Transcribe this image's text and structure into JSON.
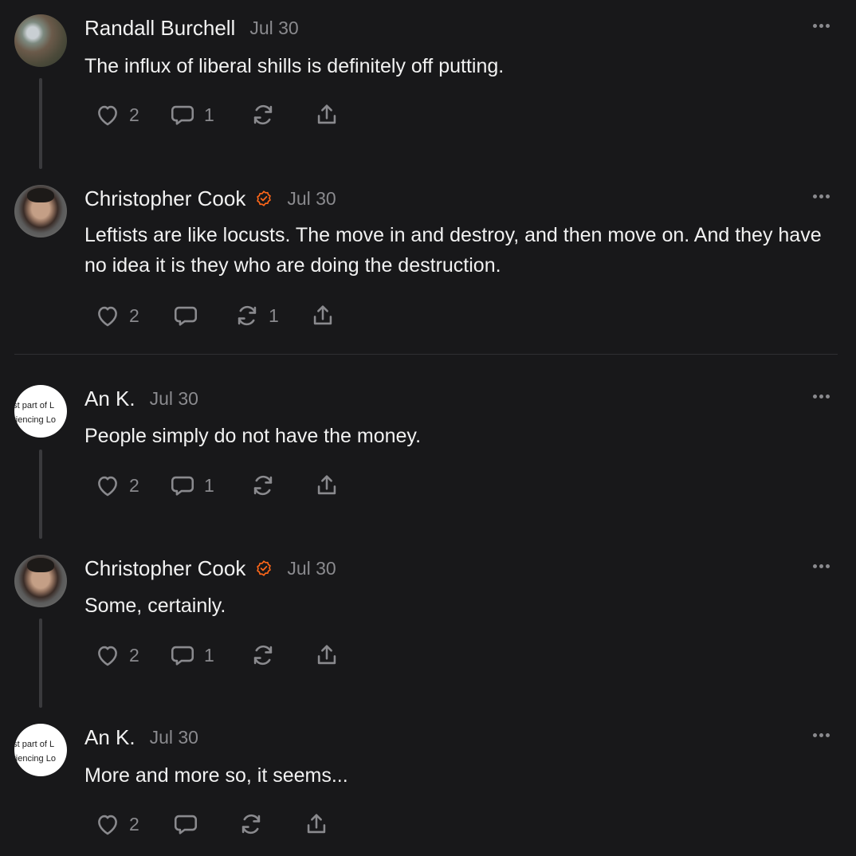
{
  "posts": [
    {
      "author": "Randall Burchell",
      "date": "Jul 30",
      "verified": false,
      "text": "The influx of liberal shills is definitely off putting.",
      "likes": "2",
      "comments": "1",
      "restacks": ""
    },
    {
      "author": "Christopher Cook",
      "date": "Jul 30",
      "verified": true,
      "text": "Leftists are like locusts. The move in and destroy, and then move on. And they have no idea it is they who are doing the destruction.",
      "likes": "2",
      "comments": "",
      "restacks": "1"
    },
    {
      "author": "An K.",
      "date": "Jul 30",
      "verified": false,
      "avatar_text": [
        "est part of L",
        "eriencing Lo"
      ],
      "text": "People simply do not have the money.",
      "likes": "2",
      "comments": "1",
      "restacks": ""
    },
    {
      "author": "Christopher Cook",
      "date": "Jul 30",
      "verified": true,
      "text": "Some, certainly.",
      "likes": "2",
      "comments": "1",
      "restacks": ""
    },
    {
      "author": "An K.",
      "date": "Jul 30",
      "verified": false,
      "avatar_text": [
        "est part of L",
        "eriencing Lo"
      ],
      "text": "More and more so, it seems...",
      "likes": "2",
      "comments": "",
      "restacks": ""
    }
  ],
  "icons": {
    "like": "heart-icon",
    "comment": "comment-bubble-icon",
    "restack": "restack-icon",
    "share": "share-icon",
    "more": "more-options-icon",
    "verified": "verified-badge-icon"
  },
  "colors": {
    "background": "#18181a",
    "text": "#f2f2f2",
    "muted": "#8a8a8e",
    "verified": "#ff6719"
  }
}
